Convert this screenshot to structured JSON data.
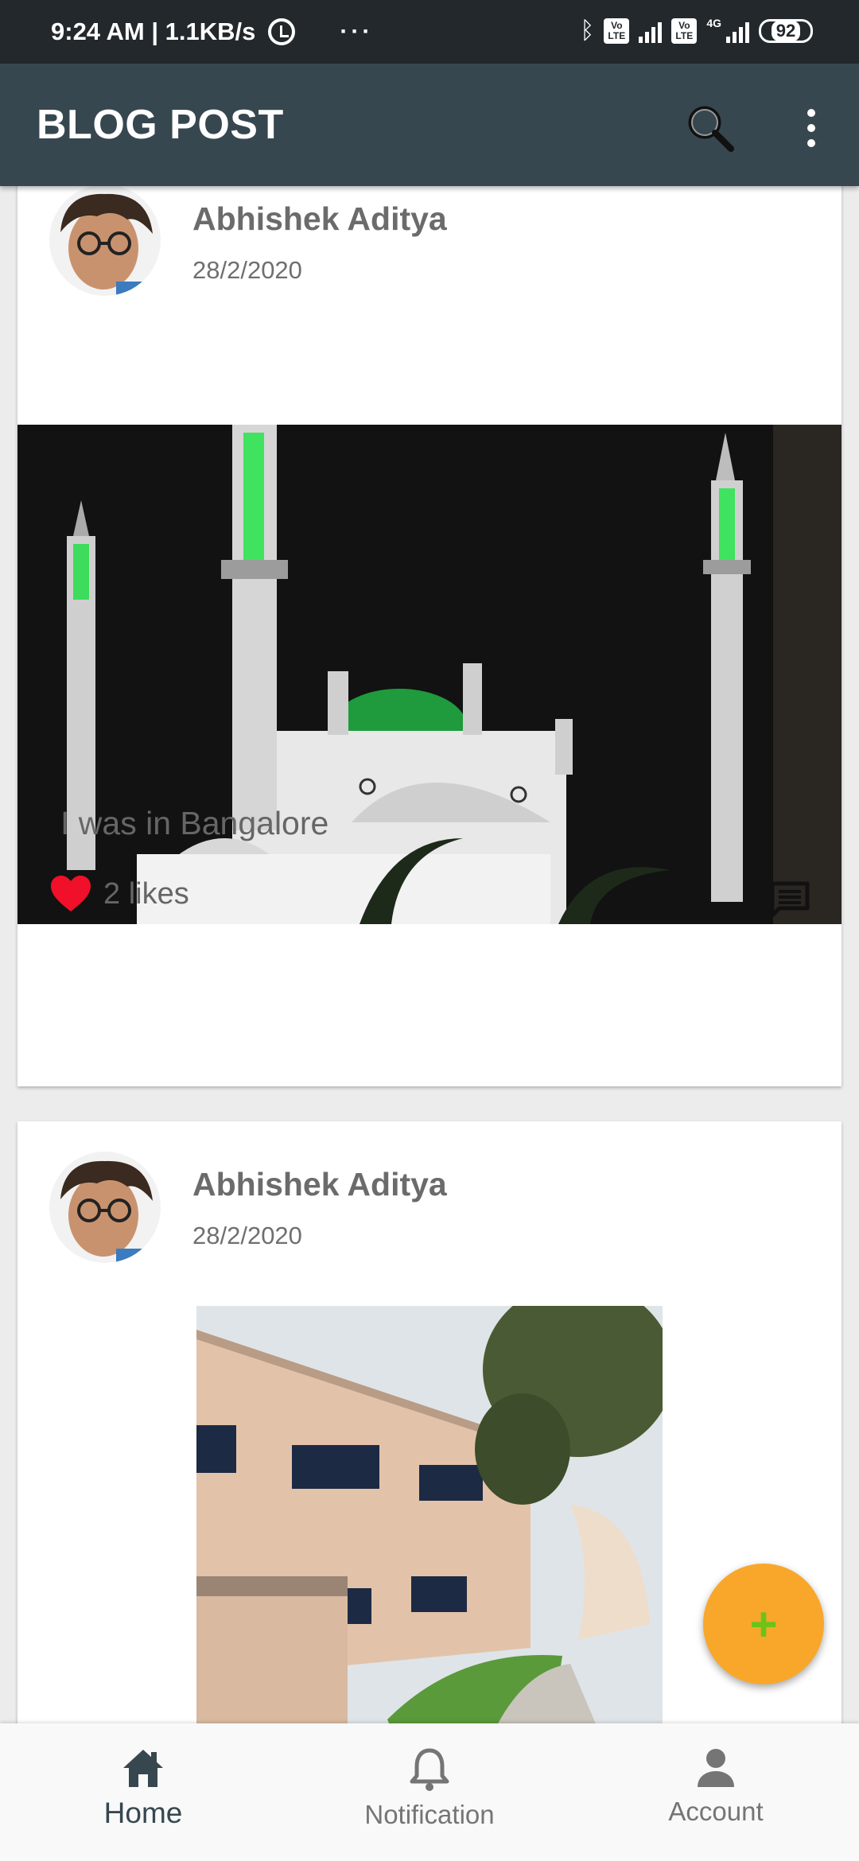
{
  "status_bar": {
    "time_speed": "9:24 AM | 1.1KB/s",
    "more": "···",
    "volte": "Vo LTE",
    "net": "4G",
    "battery": "92"
  },
  "app_bar": {
    "title": "BLOG POST"
  },
  "posts": [
    {
      "author": "Abhishek Aditya",
      "date": "28/2/2020",
      "caption": "I was in Bangalore",
      "likes": "2 likes"
    },
    {
      "author": "Abhishek Aditya",
      "date": "28/2/2020"
    }
  ],
  "fab": {
    "label": "+"
  },
  "bottom_nav": [
    {
      "label": "Home",
      "icon": "home-icon",
      "active": true
    },
    {
      "label": "Notification",
      "icon": "bell-icon",
      "active": false
    },
    {
      "label": "Account",
      "icon": "person-icon",
      "active": false
    }
  ],
  "colors": {
    "app_bar": "#37474f",
    "status_bar": "#22282c",
    "fab": "#f9a72b",
    "fab_icon": "#6cc319",
    "like_heart": "#f0102a"
  }
}
